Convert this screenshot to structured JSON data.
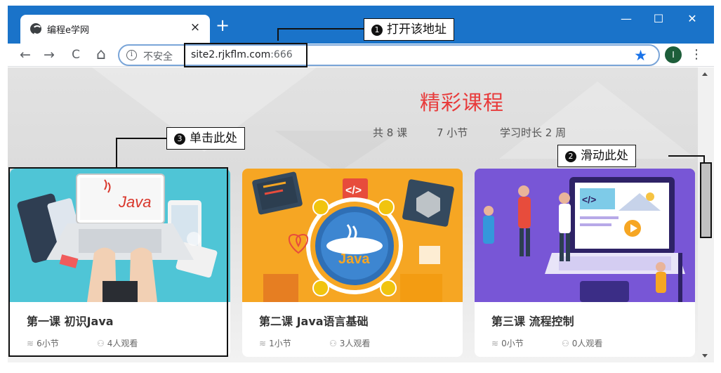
{
  "browser": {
    "tab_title": "编程e学网",
    "tab_close": "×",
    "new_tab": "+",
    "win_minimize": "—",
    "win_maximize": "☐",
    "win_close": "✕",
    "back": "←",
    "forward": "→",
    "reload": "C",
    "home": "⌂",
    "info": "i",
    "insecure_label": "不安全",
    "url_host": "site2.rjkflm.com",
    "url_port": ":666",
    "bookmark_star": "★",
    "avatar_letter": "I",
    "menu": "⋮",
    "colors": {
      "titlebar": "#1a73c9",
      "accent": "#1a73e8"
    }
  },
  "page": {
    "title": "精彩课程",
    "stats": {
      "courses": "共 8 课",
      "sections": "7 小节",
      "duration": "学习时长 2 周"
    },
    "title_color": "#e83a3a",
    "cards": [
      {
        "title": "第一课 初识Java",
        "sections": "6小节",
        "views": "4人观看",
        "banner_text": "Java",
        "bg": "#4fc5d6"
      },
      {
        "title": "第二课 Java语言基础",
        "sections": "1小节",
        "views": "3人观看",
        "banner_text": "Java",
        "bg": "#f6a623"
      },
      {
        "title": "第三课 流程控制",
        "sections": "0小节",
        "views": "0人观看",
        "banner_text": "</>",
        "bg": "#6d4bc9"
      }
    ]
  },
  "annotations": {
    "step1": {
      "num": "1",
      "text": "打开该地址"
    },
    "step2": {
      "num": "2",
      "text": "滑动此处"
    },
    "step3": {
      "num": "3",
      "text": "单击此处"
    }
  }
}
